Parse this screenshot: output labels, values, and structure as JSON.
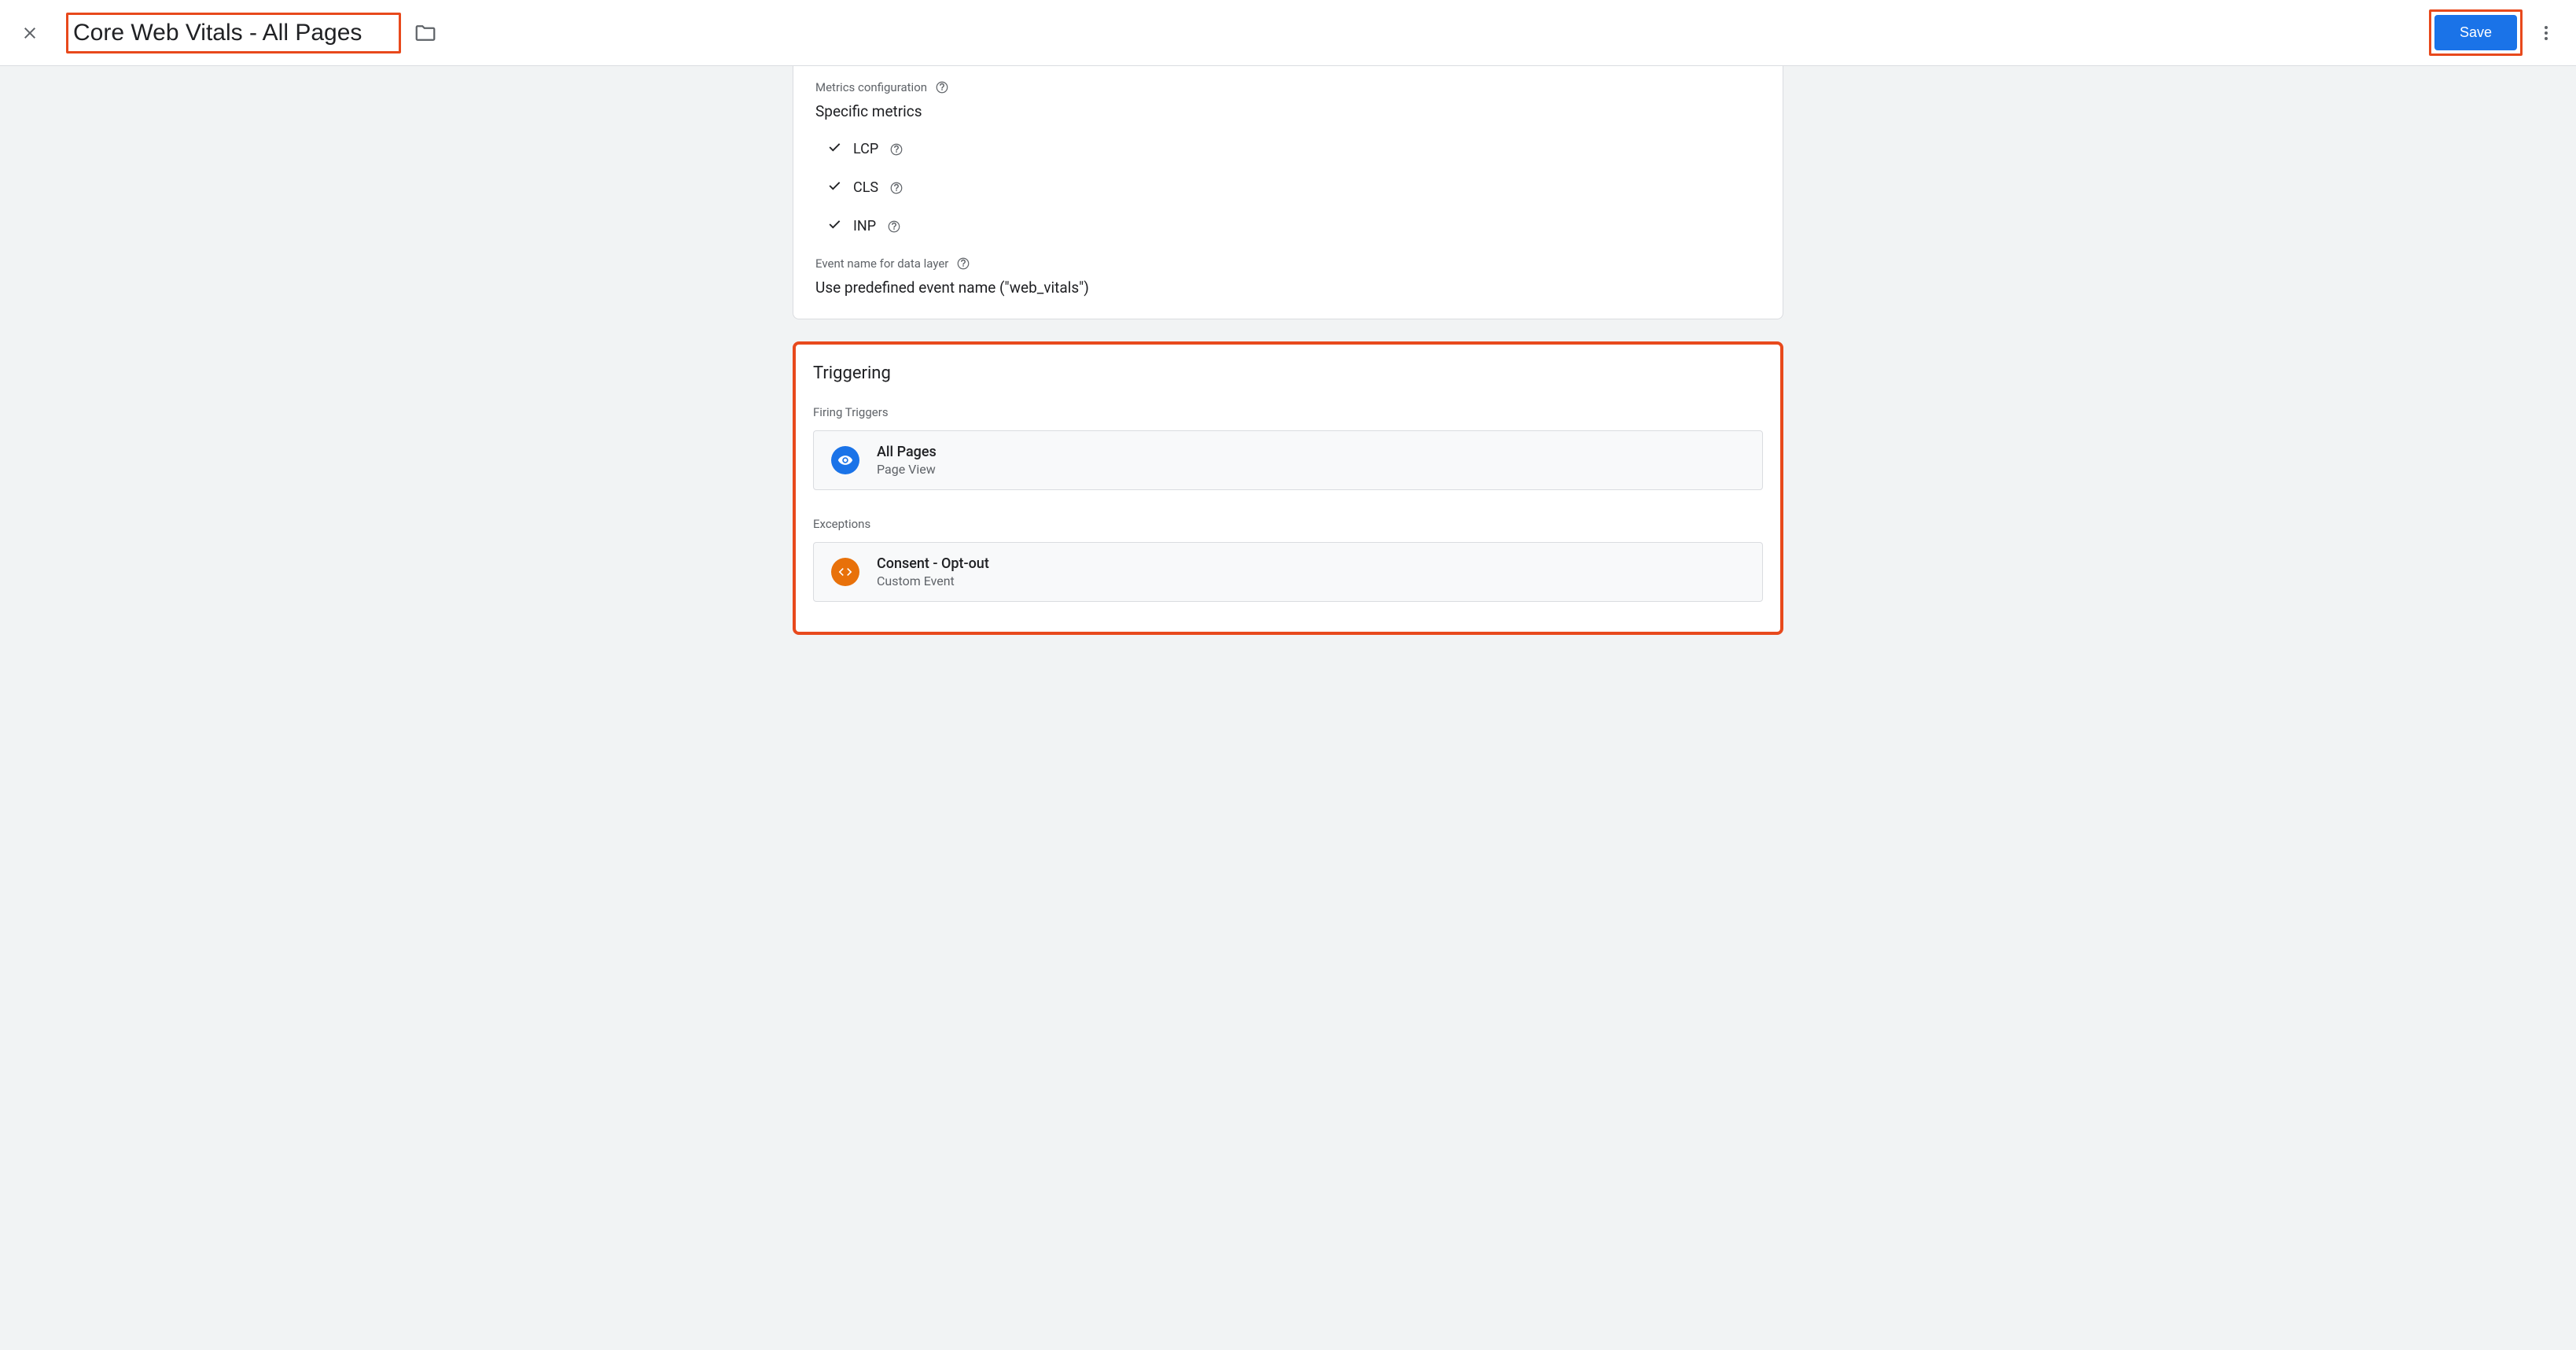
{
  "header": {
    "title": "Core Web Vitals - All Pages",
    "save_label": "Save"
  },
  "metrics": {
    "label": "Metrics configuration",
    "value": "Specific metrics",
    "items": [
      "LCP",
      "CLS",
      "INP"
    ]
  },
  "event_name": {
    "label": "Event name for data layer",
    "value": "Use predefined event name (\"web_vitals\")"
  },
  "triggering": {
    "heading": "Triggering",
    "firing_label": "Firing Triggers",
    "exceptions_label": "Exceptions",
    "firing": [
      {
        "name": "All Pages",
        "type": "Page View",
        "icon": "eye",
        "color": "blue"
      }
    ],
    "exceptions": [
      {
        "name": "Consent - Opt-out",
        "type": "Custom Event",
        "icon": "code",
        "color": "orange"
      }
    ]
  }
}
